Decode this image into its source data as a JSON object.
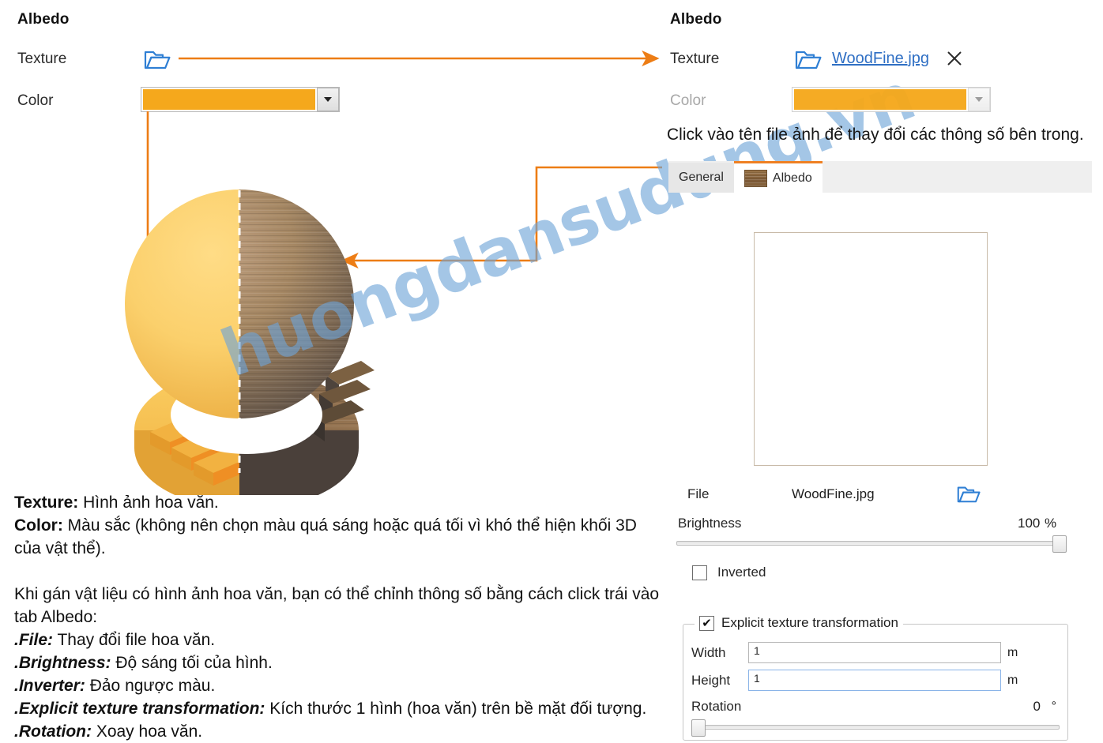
{
  "left_panel": {
    "title": "Albedo",
    "texture_label": "Texture",
    "color_label": "Color",
    "color_value": "#f5a81c",
    "folder_icon": "folder-open-icon",
    "dropdown_icon": "chevron-down-icon"
  },
  "right_panel": {
    "title": "Albedo",
    "texture_label": "Texture",
    "texture_file": "WoodFine.jpg",
    "clear_icon": "close-icon",
    "folder_icon": "folder-open-icon",
    "color_label": "Color",
    "color_value": "#f5a81c",
    "dropdown_icon": "chevron-down-icon",
    "note": "Click vào tên file ảnh để thay đổi các thông số bên trong.",
    "tabs": [
      {
        "label": "General",
        "active": false
      },
      {
        "label": "Albedo",
        "active": true
      }
    ],
    "preview_alt": "WoodFine.jpg texture preview",
    "file_row": {
      "label": "File",
      "value": "WoodFine.jpg",
      "browse_icon": "folder-open-icon"
    },
    "brightness": {
      "label": "Brightness",
      "value": "100",
      "unit": "%",
      "percent": 100
    },
    "inverted": {
      "label": "Inverted",
      "checked": false
    },
    "explicit": {
      "label": "Explicit texture transformation",
      "checked": true,
      "check_glyph": "✔",
      "width": {
        "label": "Width",
        "value": "1",
        "unit": "m"
      },
      "height": {
        "label": "Height",
        "value": "1",
        "unit": "m"
      },
      "rotation": {
        "label": "Rotation",
        "value": "0",
        "unit": "°",
        "percent": 0
      }
    }
  },
  "annotations": {
    "accent_color": "#ed7d15",
    "texture_arrow": "arrow from left Texture folder icon to right Texture row",
    "color_arrow": "arrow from left Color swatch down to sphere left half",
    "preview_arrow": "arrow from texture preview area to sphere right half"
  },
  "doc": {
    "line_texture_term": "Texture:",
    "line_texture_text": " Hình ảnh hoa văn.",
    "line_color_term": "Color:",
    "line_color_text": " Màu sắc (không nên chọn màu quá sáng hoặc quá tối vì khó thể hiện khối 3D của vật thể).",
    "paragraph": "Khi gán vật liệu có hình ảnh hoa văn, bạn có thể chỉnh thông số bằng cách click trái vào tab Albedo:",
    "bullets": [
      {
        "term": ".File:",
        "text": " Thay đổi file hoa văn."
      },
      {
        "term": ".Brightness:",
        "text": " Độ sáng tối của hình."
      },
      {
        "term": ".Inverter:",
        "text": " Đảo ngược màu."
      },
      {
        "term": ".Explicit texture transformation:",
        "text": " Kích thước 1 hình (hoa văn) trên bề mặt đối tượng."
      },
      {
        "term": ".Rotation:",
        "text": " Xoay hoa văn."
      }
    ]
  },
  "watermark": {
    "text": "huongdansudung.vn",
    "color": "#6ea4d8"
  }
}
